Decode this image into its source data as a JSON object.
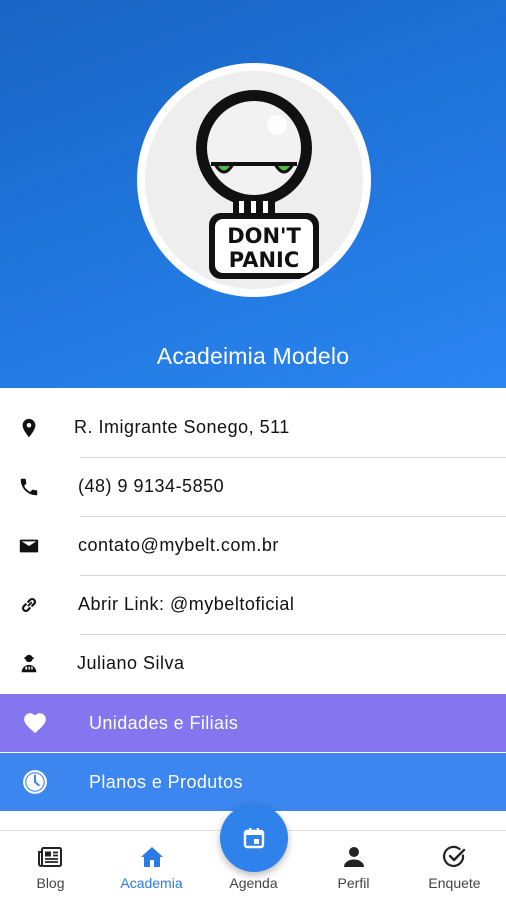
{
  "header": {
    "title": "Acadeimia Modelo",
    "avatar_caption_line1": "DON'T",
    "avatar_caption_line2": "PANIC"
  },
  "info": [
    {
      "icon": "location-pin-icon",
      "text": "R. Imigrante Sonego, 511"
    },
    {
      "icon": "phone-icon",
      "text": "(48) 9 9134-5850"
    },
    {
      "icon": "email-icon",
      "text": "contato@mybelt.com.br"
    },
    {
      "icon": "link-icon",
      "text": "Abrir Link: @mybeltoficial"
    },
    {
      "icon": "instructor-icon",
      "text": "Juliano Silva"
    }
  ],
  "actions": [
    {
      "icon": "heart-icon",
      "label": "Unidades e Filiais",
      "color": "#8576f0"
    },
    {
      "icon": "clock-icon",
      "label": "Planos e Produtos",
      "color": "#3b87ef"
    }
  ],
  "nav": {
    "items": [
      {
        "icon": "newspaper-icon",
        "label": "Blog"
      },
      {
        "icon": "home-icon",
        "label": "Academia",
        "active": true
      },
      {
        "icon": "calendar-icon",
        "label": "Agenda"
      },
      {
        "icon": "person-icon",
        "label": "Perfil"
      },
      {
        "icon": "check-circle-icon",
        "label": "Enquete"
      }
    ],
    "active_color": "#2c7be5"
  },
  "colors": {
    "header_gradient_start": "#1864c4",
    "header_gradient_end": "#2b86f2"
  }
}
